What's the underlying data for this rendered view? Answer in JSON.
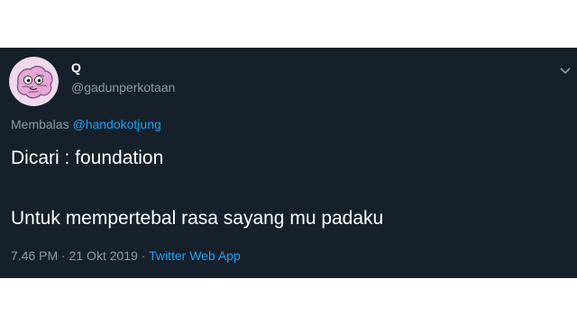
{
  "tweet": {
    "display_name": "Q",
    "handle": "@gadunperkotaan",
    "avatar_icon": "brain-icon",
    "reply_prefix": "Membalas",
    "reply_to": "@handokotjung",
    "text_line1": "Dicari : foundation",
    "text_line2": "Untuk mempertebal rasa sayang mu padaku",
    "time": "7.46 PM",
    "separator1": " · ",
    "date": "21 Okt 2019",
    "separator2": " · ",
    "source": "Twitter Web App"
  },
  "colors": {
    "background": "#15202b",
    "text": "#ffffff",
    "secondary_text": "#8899a6",
    "link": "#1da1f2",
    "avatar_bg": "#f0d9ec",
    "brain": "#e6a6d8"
  }
}
